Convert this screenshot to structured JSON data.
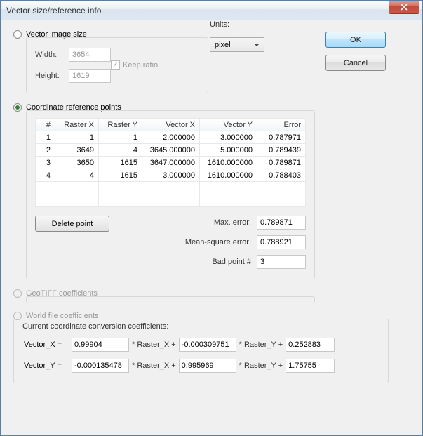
{
  "window": {
    "title": "Vector size/reference info"
  },
  "buttons": {
    "ok": "OK",
    "cancel": "Cancel",
    "delete_point": "Delete point"
  },
  "radios": {
    "vector_image_size": "Vector image size",
    "coordinate_reference_points": "Coordinate reference points",
    "geotiff": "GeoTIFF coefficients",
    "worldfile": "World file coefficients"
  },
  "image_size": {
    "width_label": "Width:",
    "width_value": "3654",
    "height_label": "Height:",
    "height_value": "1619",
    "keep_ratio": "Keep ratio"
  },
  "units": {
    "label": "Units:",
    "value": "pixel"
  },
  "table": {
    "headers": [
      "#",
      "Raster X",
      "Raster Y",
      "Vector X",
      "Vector Y",
      "Error"
    ],
    "rows": [
      [
        "1",
        "1",
        "1",
        "2.000000",
        "3.000000",
        "0.787971"
      ],
      [
        "2",
        "3649",
        "4",
        "3645.000000",
        "5.000000",
        "0.789439"
      ],
      [
        "3",
        "3650",
        "1615",
        "3647.000000",
        "1610.000000",
        "0.789871"
      ],
      [
        "4",
        "4",
        "1615",
        "3.000000",
        "1610.000000",
        "0.788403"
      ]
    ]
  },
  "stats": {
    "max_error_label": "Max. error:",
    "max_error": "0.789871",
    "msq_label": "Mean-square error:",
    "msq": "0.788921",
    "bad_label": "Bad point #",
    "bad": "3"
  },
  "coef": {
    "heading": "Current coordinate conversion coefficients:",
    "vx_label": "Vector_X =",
    "vy_label": "Vector_Y =",
    "rx_suffix": "* Raster_X +",
    "ry_suffix": "* Raster_Y +",
    "vx_a": "0.99904",
    "vx_b": "-0.000309751",
    "vx_c": "0.252883",
    "vy_a": "-0.000135478",
    "vy_b": "0.995969",
    "vy_c": "1.75755"
  }
}
